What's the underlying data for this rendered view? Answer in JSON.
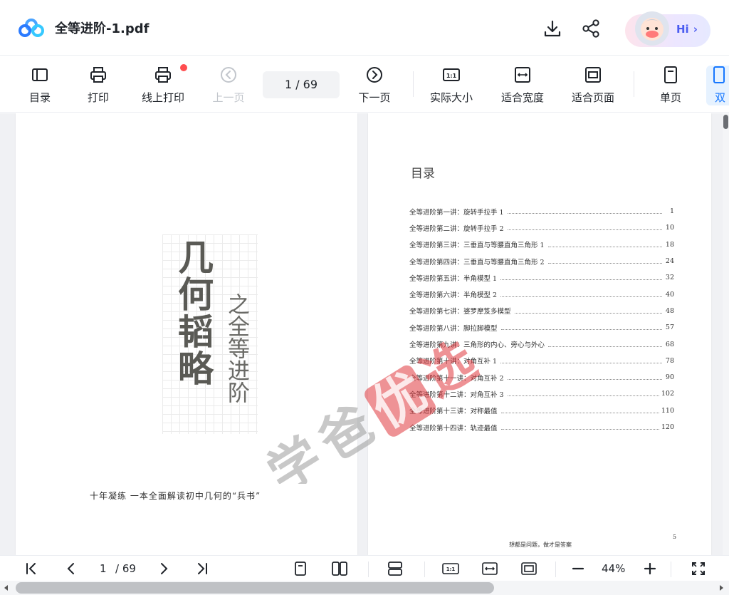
{
  "app": {
    "file_name": "全等进阶-1.pdf",
    "hi_label": "Hi"
  },
  "toolbar": {
    "toc_label": "目录",
    "print_label": "打印",
    "online_print_label": "线上打印",
    "prev_label": "上一页",
    "page_indicator": "1 / 69",
    "next_label": "下一页",
    "actual_size_label": "实际大小",
    "fit_width_label": "适合宽度",
    "fit_page_label": "适合页面",
    "single_page_label": "单页",
    "double_page_label": "双"
  },
  "pdf_left": {
    "title_main": "几何韬略",
    "title_sub": "之全等进阶",
    "tagline": "十年凝练 一本全面解读初中几何的“兵书”"
  },
  "pdf_right": {
    "heading": "目录",
    "toc": [
      {
        "title": "全等进阶第一讲：旋转手拉手 1",
        "page": "1"
      },
      {
        "title": "全等进阶第二讲：旋转手拉手 2",
        "page": "10"
      },
      {
        "title": "全等进阶第三讲：三垂直与等腰直角三角形 1",
        "page": "18"
      },
      {
        "title": "全等进阶第四讲：三垂直与等腰直角三角形 2",
        "page": "24"
      },
      {
        "title": "全等进阶第五讲：半角模型 1",
        "page": "32"
      },
      {
        "title": "全等进阶第六讲：半角模型 2",
        "page": "40"
      },
      {
        "title": "全等进阶第七讲：婆罗摩笈多模型",
        "page": "48"
      },
      {
        "title": "全等进阶第八讲：脚拉脚模型",
        "page": "57"
      },
      {
        "title": "全等进阶第九讲：三角形的内心、旁心与外心",
        "page": "68"
      },
      {
        "title": "全等进阶第十讲：对角互补 1",
        "page": "78"
      },
      {
        "title": "全等进阶第十一讲：对角互补 2",
        "page": "90"
      },
      {
        "title": "全等进阶第十二讲：对角互补 3",
        "page": "102"
      },
      {
        "title": "全等进阶第十三讲：对称最值",
        "page": "110"
      },
      {
        "title": "全等进阶第十四讲：轨迹最值",
        "page": "120"
      }
    ],
    "footer_note": "想都是问题，做才是答案",
    "page_number": "5"
  },
  "watermark": {
    "text": "学爸优选"
  },
  "bottombar": {
    "page_current": "1",
    "page_total": "/ 69",
    "zoom": "44%"
  },
  "colors": {
    "accent": "#1677ff",
    "notification_dot": "#ff4d4f",
    "watermark_red": "#e0393e"
  }
}
